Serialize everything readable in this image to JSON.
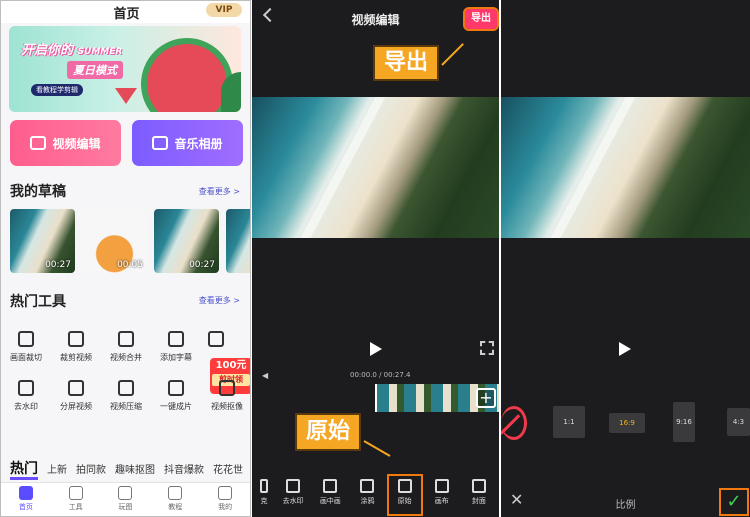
{
  "home": {
    "title": "首页",
    "vip": "VIP",
    "banner": {
      "headline": "开启你的",
      "headline_en": "SUMMER",
      "subtitle": "夏日模式",
      "caption": "看教程学剪辑"
    },
    "actions": {
      "video_edit": "视频编辑",
      "music_album": "音乐相册"
    },
    "drafts": {
      "title": "我的草稿",
      "more": "查看更多 >",
      "items": [
        {
          "duration": "00:27"
        },
        {
          "duration": "00:05"
        },
        {
          "duration": "00:27"
        }
      ]
    },
    "tools": {
      "title": "热门工具",
      "more": "查看更多 >",
      "row1": [
        "画面裁切",
        "裁剪视频",
        "视频合并",
        "添加字幕"
      ],
      "row2": [
        "去水印",
        "分屏视频",
        "视频压缩",
        "一键成片",
        "视频抠像"
      ],
      "promo": {
        "amount": "100元",
        "label": "剪时领"
      }
    },
    "hot_tabs": [
      "热门",
      "上新",
      "拍同款",
      "趣味抠图",
      "抖音爆款",
      "花花世"
    ],
    "tabbar": [
      "首页",
      "工具",
      "玩图",
      "教程",
      "我的"
    ]
  },
  "editor": {
    "title": "视频编辑",
    "export_label": "导出",
    "callout_export": "导出",
    "callout_original": "原始",
    "timecode": "00:00.0 / 00:27.4",
    "add_clip": "+",
    "toolbar": [
      "克",
      "去水印",
      "画中画",
      "涂鸦",
      "原始",
      "画布",
      "封面"
    ]
  },
  "ratio_panel": {
    "ratios": [
      "1:1",
      "16:9",
      "9:16",
      "4:3"
    ],
    "selected": "16:9",
    "label": "比例",
    "close": "✕",
    "confirm": "✓"
  },
  "colors": {
    "accent": "#6b4cff",
    "export_red": "#ff3a6a",
    "callout_orange": "#f5a623",
    "highlight_outline": "#f07a10",
    "confirm_green": "#3fd45a"
  }
}
